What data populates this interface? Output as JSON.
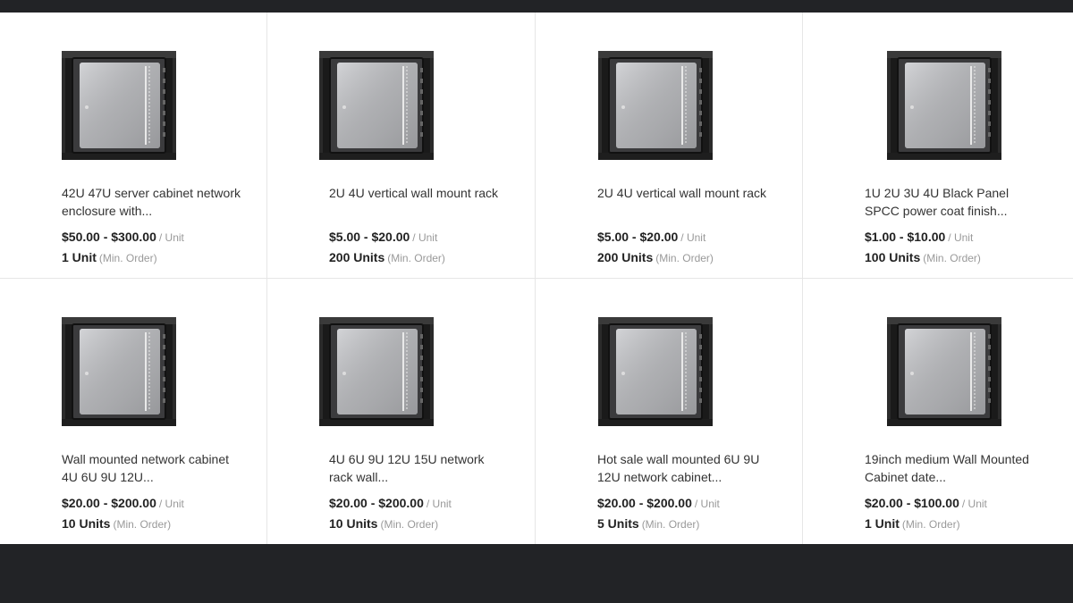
{
  "products": [
    {
      "title": "42U 47U server cabinet network enclosure with...",
      "price": "$50.00 - $300.00",
      "unit": "/ Unit",
      "moq": "1 Unit",
      "moq_note": "(Min. Order)",
      "image": "wall-mount-cabinet-image"
    },
    {
      "title": "2U 4U vertical wall mount rack",
      "price": "$5.00 - $20.00",
      "unit": "/ Unit",
      "moq": "200 Units",
      "moq_note": "(Min. Order)",
      "image": "wall-mount-cabinet-image"
    },
    {
      "title": "2U 4U vertical wall mount rack",
      "price": "$5.00 - $20.00",
      "unit": "/ Unit",
      "moq": "200 Units",
      "moq_note": "(Min. Order)",
      "image": "wall-mount-cabinet-image"
    },
    {
      "title": "1U 2U 3U 4U Black Panel SPCC power coat finish...",
      "price": "$1.00 - $10.00",
      "unit": "/ Unit",
      "moq": "100 Units",
      "moq_note": "(Min. Order)",
      "image": "wall-mount-cabinet-image"
    },
    {
      "title": "Wall mounted network cabinet 4U 6U 9U 12U...",
      "price": "$20.00 - $200.00",
      "unit": "/ Unit",
      "moq": "10 Units",
      "moq_note": "(Min. Order)",
      "image": "wall-mount-cabinet-image"
    },
    {
      "title": "4U 6U 9U 12U 15U network rack wall...",
      "price": "$20.00 - $200.00",
      "unit": "/ Unit",
      "moq": "10 Units",
      "moq_note": "(Min. Order)",
      "image": "wall-mount-cabinet-image"
    },
    {
      "title": "Hot sale wall mounted 6U 9U 12U network cabinet...",
      "price": "$20.00 - $200.00",
      "unit": "/ Unit",
      "moq": "5 Units",
      "moq_note": "(Min. Order)",
      "image": "wall-mount-cabinet-image"
    },
    {
      "title": "19inch medium Wall Mounted Cabinet date...",
      "price": "$20.00 - $100.00",
      "unit": "/ Unit",
      "moq": "1 Unit",
      "moq_note": "(Min. Order)",
      "image": "wall-mount-cabinet-image"
    }
  ]
}
